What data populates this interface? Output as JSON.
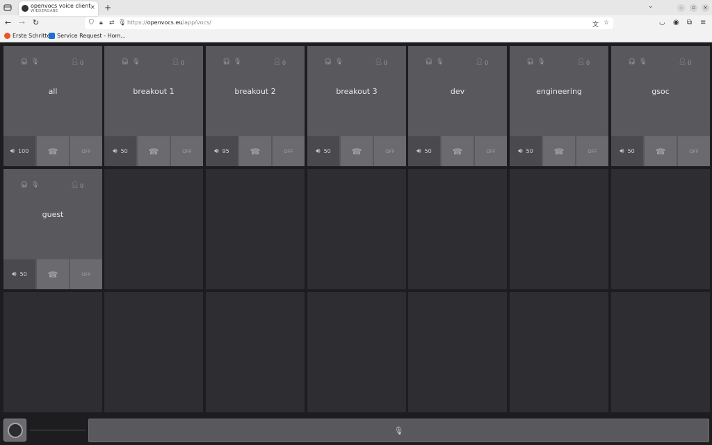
{
  "browser": {
    "tab": {
      "title": "openvocs voice client",
      "subtitle": "WIEDERGABE",
      "close_icon": "×"
    },
    "new_tab_icon": "+",
    "url": {
      "scheme": "https://",
      "host": "openvocs.eu",
      "path": "/app/vocs/"
    },
    "bookmarks": [
      {
        "label": "Erste Schritte",
        "color": "#e7572a"
      },
      {
        "label": "Service Request - Hom...",
        "color": "#1f6fd1"
      }
    ]
  },
  "loops": [
    {
      "name": "all",
      "volume": "100",
      "users": "0",
      "status": "OFF"
    },
    {
      "name": "breakout 1",
      "volume": "50",
      "users": "0",
      "status": "OFF"
    },
    {
      "name": "breakout 2",
      "volume": "95",
      "users": "0",
      "status": "OFF"
    },
    {
      "name": "breakout 3",
      "volume": "50",
      "users": "0",
      "status": "OFF"
    },
    {
      "name": "dev",
      "volume": "50",
      "users": "0",
      "status": "OFF"
    },
    {
      "name": "engineering",
      "volume": "50",
      "users": "0",
      "status": "OFF"
    },
    {
      "name": "gsoc",
      "volume": "50",
      "users": "0",
      "status": "OFF"
    },
    {
      "name": "guest",
      "volume": "50",
      "users": "0",
      "status": "OFF"
    }
  ],
  "colors": {
    "tile": "#59585d",
    "empty_tile": "#2e2d31",
    "background": "#1d1c1f"
  }
}
